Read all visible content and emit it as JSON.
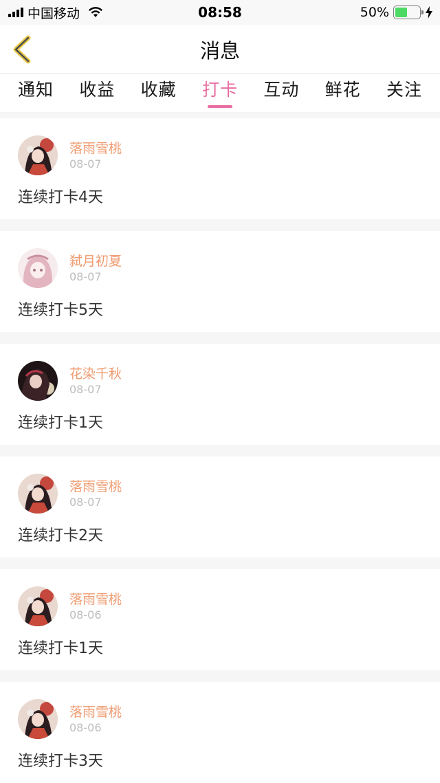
{
  "status_bar": {
    "carrier": "中国移动",
    "time": "08:58",
    "battery_percent": "50%",
    "battery_level": 0.5
  },
  "nav": {
    "title": "消息",
    "back_icon": "chevron-left-icon"
  },
  "colors": {
    "accent": "#e86da1",
    "username": "#ef9a6e",
    "back_arrow": "#e8c94a",
    "battery": "#4cd964"
  },
  "tabs": [
    {
      "label": "通知"
    },
    {
      "label": "收益"
    },
    {
      "label": "收藏"
    },
    {
      "label": "打卡",
      "active": true
    },
    {
      "label": "互动"
    },
    {
      "label": "鲜花"
    },
    {
      "label": "关注"
    }
  ],
  "messages": [
    {
      "user": "落雨雪桃",
      "date": "08-07",
      "text": "连续打卡4天",
      "avatar": "avatar-dark-girl"
    },
    {
      "user": "弑月初夏",
      "date": "08-07",
      "text": "连续打卡5天",
      "avatar": "avatar-pink-girl"
    },
    {
      "user": "花染千秋",
      "date": "08-07",
      "text": "连续打卡1天",
      "avatar": "avatar-night-girl"
    },
    {
      "user": "落雨雪桃",
      "date": "08-07",
      "text": "连续打卡2天",
      "avatar": "avatar-dark-girl"
    },
    {
      "user": "落雨雪桃",
      "date": "08-06",
      "text": "连续打卡1天",
      "avatar": "avatar-dark-girl"
    },
    {
      "user": "落雨雪桃",
      "date": "08-06",
      "text": "连续打卡3天",
      "avatar": "avatar-dark-girl"
    }
  ]
}
